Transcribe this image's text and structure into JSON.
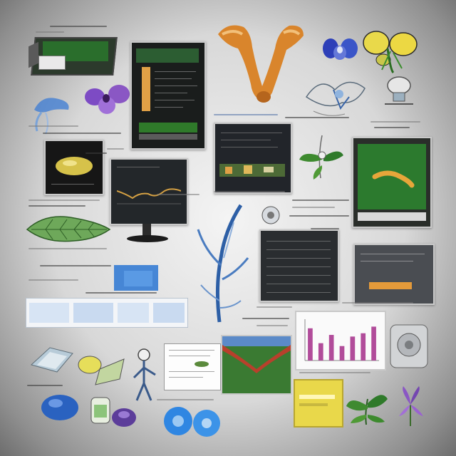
{
  "scene": {
    "description_type": "illustrated collage",
    "palette": {
      "background_center": "#f4f4f4",
      "background_edge": "#6d6d6d",
      "screen_dark": "#1d1f22",
      "accent_orange": "#e49a3a",
      "accent_green": "#2f7a2a",
      "accent_purple": "#8a57c4",
      "accent_blue": "#2a76d2",
      "chart_bar": "#b14c9a",
      "card_yellow": "#e9d84a"
    }
  },
  "chart_data": {
    "type": "bar",
    "categories": [
      "",
      "",
      "",
      "",
      "",
      "",
      ""
    ],
    "values": [
      0.78,
      0.42,
      0.62,
      0.35,
      0.58,
      0.66,
      0.82
    ],
    "title": "",
    "xlabel": "",
    "ylabel": "",
    "ylim": [
      0,
      1
    ]
  },
  "icons": [
    "green-monitor-icon",
    "orchid-flower-icon",
    "root-specimen-icon",
    "blue-flower-icon",
    "yellow-butterfly-icon",
    "lamp-icon",
    "blue-tree-sketch-icon",
    "leaf-specimen-icon",
    "blue-disc-icon",
    "cd-icon",
    "printer-icon",
    "yellow-card-icon",
    "green-plant-icon",
    "purple-iris-icon"
  ]
}
